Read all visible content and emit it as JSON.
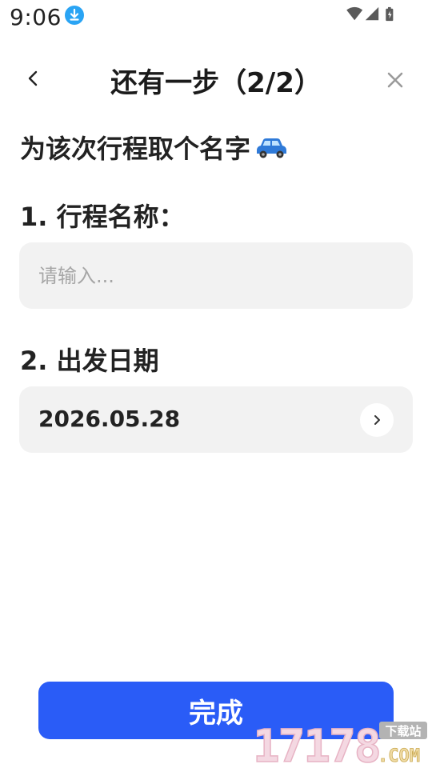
{
  "status_bar": {
    "time": "9:06",
    "icons": [
      "download-icon",
      "wifi-icon",
      "signal-icon",
      "battery-icon"
    ]
  },
  "header": {
    "title": "还有一步（2/2）",
    "back_icon": "chevron-left-icon",
    "close_icon": "close-icon"
  },
  "heading": {
    "text": "为该次行程取个名字",
    "emoji_icon": "car-icon"
  },
  "trip_name": {
    "label": "1. 行程名称：",
    "placeholder": "请输入...",
    "value": ""
  },
  "departure_date": {
    "label": "2. 出发日期",
    "value": "2026.05.28",
    "icon": "chevron-right-icon"
  },
  "footer": {
    "done_label": "完成"
  },
  "watermark": {
    "numbers": "17178",
    "suffix": ".COM",
    "tag": "下载站"
  },
  "colors": {
    "accent": "#2a5cf7",
    "field_bg": "#f2f2f2",
    "download_badge": "#2aa4f4",
    "car": "#2f7ad8"
  }
}
